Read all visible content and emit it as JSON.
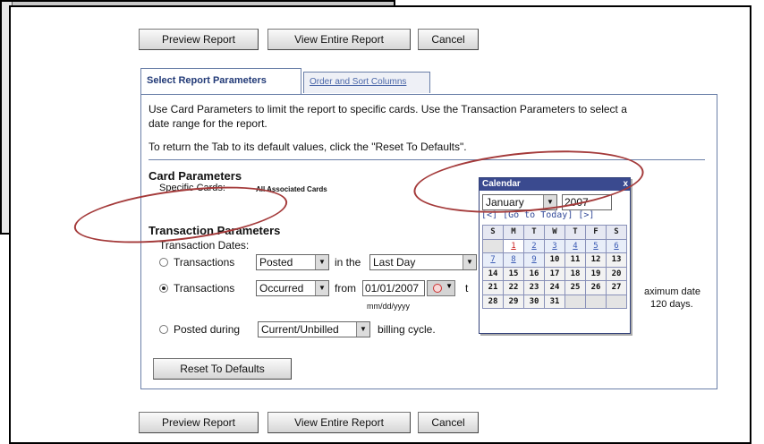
{
  "top_buttons": {
    "preview": "Preview Report",
    "view_entire": "View Entire Report",
    "cancel": "Cancel"
  },
  "bottom_buttons": {
    "preview": "Preview Report",
    "view_entire": "View Entire Report",
    "cancel": "Cancel"
  },
  "tabs": {
    "active": "Select Report Parameters",
    "inactive": "Order and Sort Columns"
  },
  "intro": {
    "line1": "Use Card Parameters to limit the report to specific cards. Use the Transaction Parameters to select a",
    "line2": "date range for the report.",
    "line3": "To return the Tab to its default values, click the \"Reset To Defaults\"."
  },
  "card_params": {
    "heading": "Card Parameters",
    "specific_label": "Specific Cards:",
    "specific_value": "All Associated Cards"
  },
  "txn_params": {
    "heading": "Transaction Parameters",
    "dates_label": "Transaction Dates:",
    "opt1_label": "Transactions",
    "opt1_type": "Posted",
    "opt1_mid": "in the",
    "opt1_period": "Last Day",
    "opt2_label": "Transactions",
    "opt2_type": "Occurred",
    "opt2_mid": "from",
    "opt2_from": "01/01/2007",
    "opt2_to_prefix": "t",
    "date_format": "mm/dd/yyyy",
    "max_note_1": "aximum date",
    "max_note_2": "120 days.",
    "opt3_label": "Posted during",
    "opt3_cycle": "Current/Unbilled",
    "opt3_suffix": "billing cycle."
  },
  "reset_button": "Reset To Defaults",
  "calendar": {
    "title": "Calendar",
    "close": "x",
    "month": "January",
    "year": "2007",
    "nav": "[<]  [Go to Today]  [>]",
    "weekday_headers": [
      "S",
      "M",
      "T",
      "W",
      "T",
      "F",
      "S"
    ],
    "week1": [
      "",
      "1",
      "2",
      "3",
      "4",
      "5",
      "6"
    ],
    "week2": [
      "7",
      "8",
      "9",
      "10",
      "11",
      "12",
      "13"
    ],
    "week3": [
      "14",
      "15",
      "16",
      "17",
      "18",
      "19",
      "20"
    ],
    "week4": [
      "21",
      "22",
      "23",
      "24",
      "25",
      "26",
      "27"
    ],
    "week5": [
      "28",
      "29",
      "30",
      "31",
      "",
      "",
      ""
    ]
  },
  "colors": {
    "tab_border": "#6a7fa8",
    "calendar_title": "#3a4a8f",
    "highlight": "#a43a3a"
  }
}
